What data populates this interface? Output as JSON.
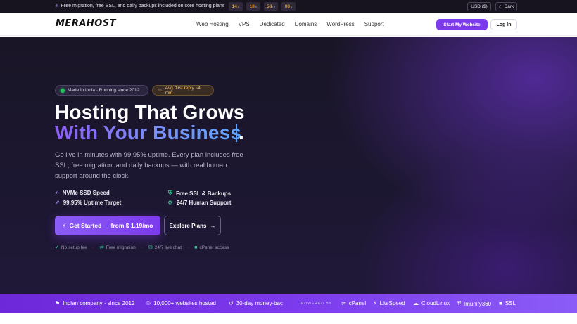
{
  "topbar": {
    "promo": "Free migration, free SSL, and daily backups included on core hosting plans",
    "countdown": [
      {
        "value": "14",
        "unit": "d"
      },
      {
        "value": "10",
        "unit": "h"
      },
      {
        "value": "58",
        "unit": "m"
      },
      {
        "value": "08",
        "unit": "s"
      }
    ],
    "currency": "USD ($)",
    "theme_toggle": "Dark"
  },
  "nav": {
    "logo": "MERAHOST",
    "items": [
      "Web Hosting",
      "VPS",
      "Dedicated",
      "Domains",
      "WordPress",
      "Support"
    ],
    "cta": "Start My Website",
    "login": "Log In"
  },
  "hero": {
    "badge_location": "Made in India · Running since 2012",
    "badge_reply": "Avg. first reply ~4 min",
    "title_line1": "Hosting That Grows",
    "title_line2": "With Your Business",
    "title_end": ".",
    "lead": "Go live in minutes with 99.95% uptime. Every plan includes free SSL, free migration, and daily backups — with real human support around the clock.",
    "features": [
      "NVMe SSD Speed",
      "Free SSL & Backups",
      "99.95% Uptime Target",
      "24/7 Human Support"
    ],
    "primary_cta": "Get Started — from $ 1.19/mo",
    "secondary_cta": "Explore Plans",
    "perks": [
      "No setup fee",
      "Free migration",
      "24/7 live chat",
      "cPanel access"
    ]
  },
  "strip": {
    "company": "Indian company · since 2012",
    "sites": "10,000+ websites hosted",
    "guarantee": "30-day money-bac",
    "powered_by": "POWERED BY",
    "tech": [
      "cPanel",
      "LiteSpeed",
      "CloudLinux",
      "Imunify360",
      "SSL"
    ]
  },
  "colors": {
    "accent": "#7c3aed",
    "hero_bg": "#1c1730",
    "success": "#34d399",
    "warning": "#f59e0b"
  }
}
